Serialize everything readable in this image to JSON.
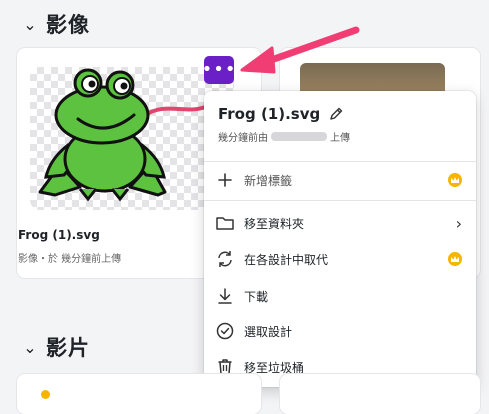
{
  "sections": {
    "images": {
      "title": "影像"
    },
    "videos": {
      "title": "影片"
    }
  },
  "image_card": {
    "name": "Frog (1).svg",
    "meta": "影像・於 幾分鐘前上傳",
    "more_button_label": "•••"
  },
  "menu": {
    "title": "Frog (1).svg",
    "subtitle_prefix": "幾分鐘前由",
    "subtitle_suffix": "上傳",
    "items": [
      {
        "label": "新增標籤",
        "icon": "plus-icon",
        "premium": true
      },
      {
        "label": "移至資料夾",
        "icon": "folder-icon",
        "submenu": true
      },
      {
        "label": "在各設計中取代",
        "icon": "replace-icon",
        "premium": true
      },
      {
        "label": "下載",
        "icon": "download-icon"
      },
      {
        "label": "選取設計",
        "icon": "check-circle-icon"
      },
      {
        "label": "移至垃圾桶",
        "icon": "trash-icon"
      }
    ]
  },
  "colors": {
    "accent": "#6b1fc7",
    "arrow": "#f03d73",
    "premium": "#f7b500",
    "frog_green": "#5cc23f"
  }
}
